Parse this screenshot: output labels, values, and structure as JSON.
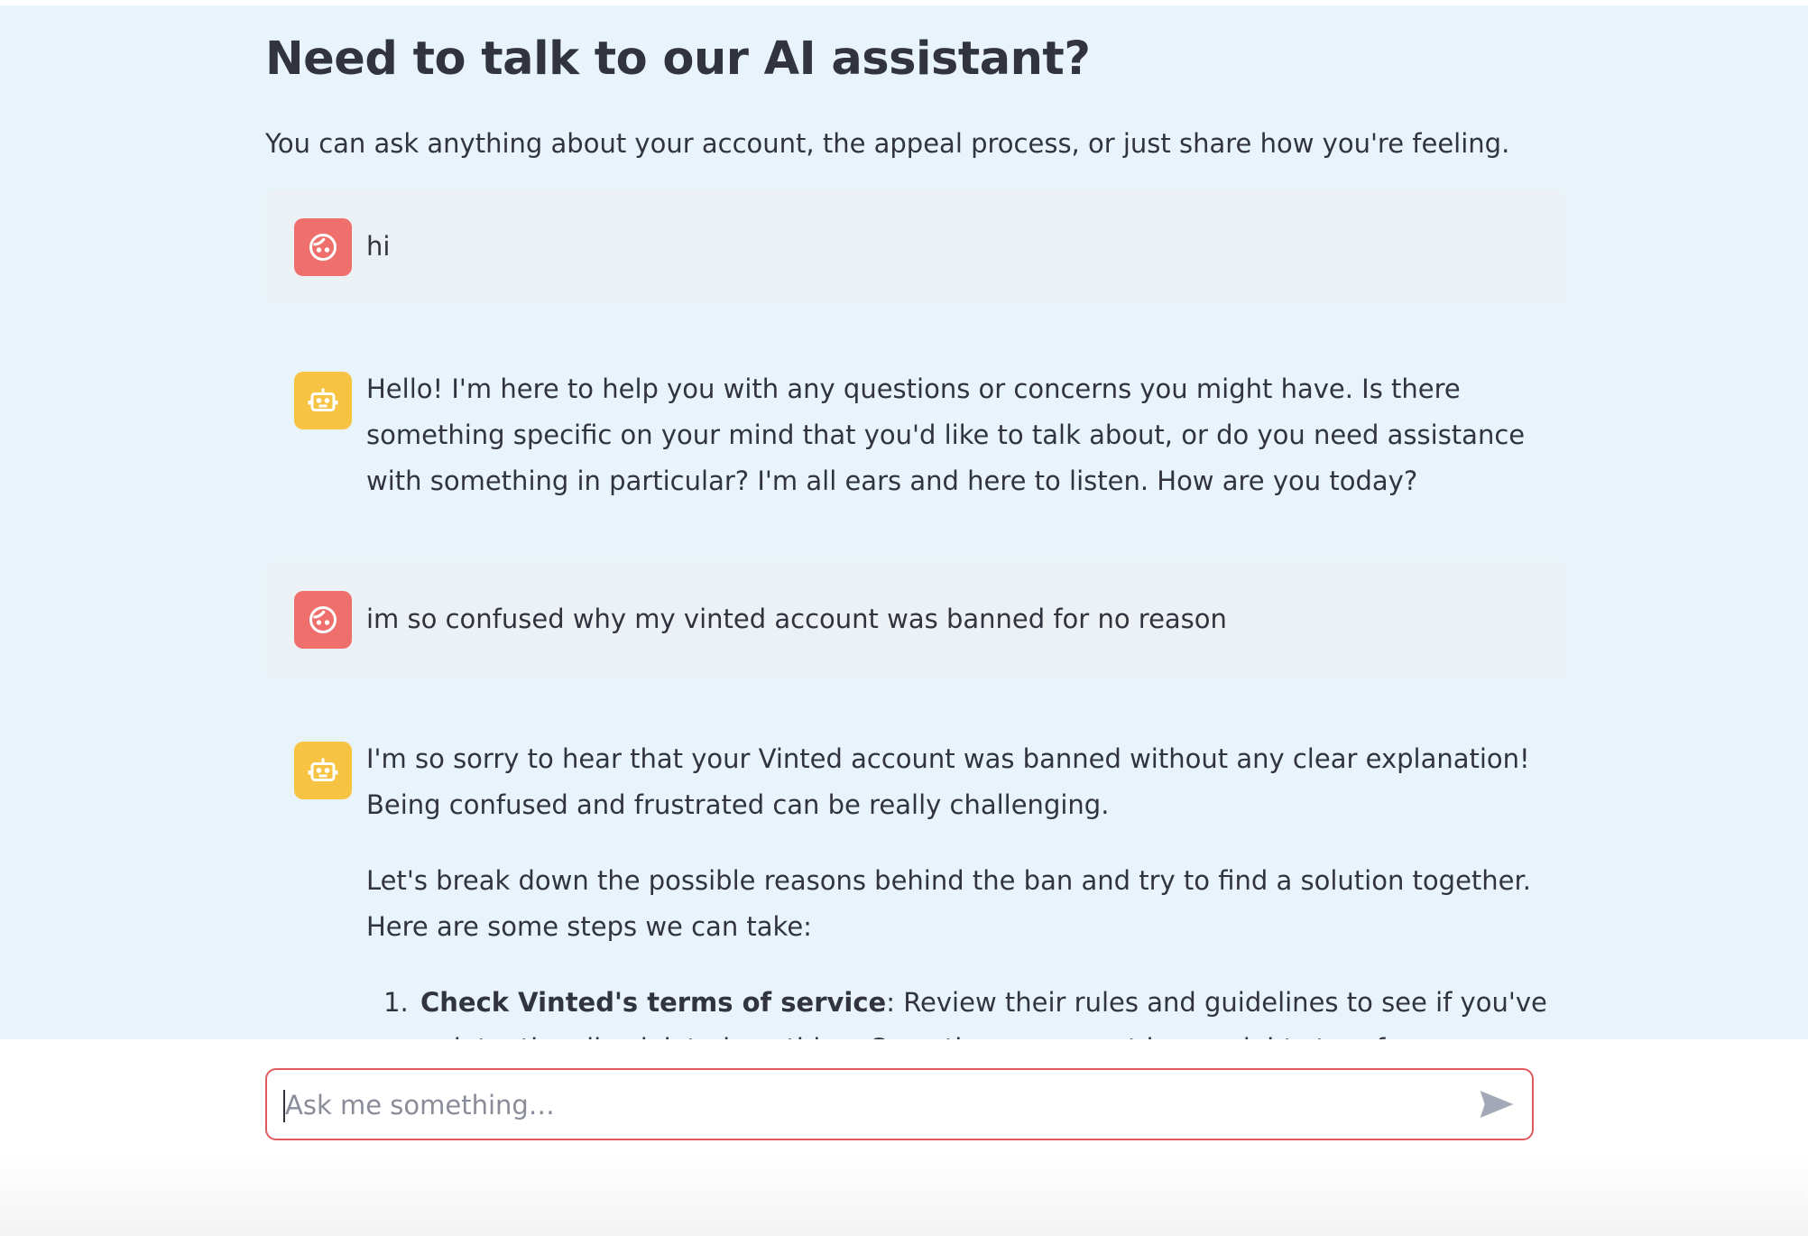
{
  "header": {
    "title": "Need to talk to our AI assistant?",
    "subtitle": "You can ask anything about your account, the appeal process, or just share how you're feeling."
  },
  "messages": [
    {
      "role": "user",
      "avatar_icon": "face-icon",
      "text": "hi"
    },
    {
      "role": "assistant",
      "avatar_icon": "robot-icon",
      "text": "Hello! I'm here to help you with any questions or concerns you might have. Is there something specific on your mind that you'd like to talk about, or do you need assistance with something in particular? I'm all ears and here to listen. How are you today?"
    },
    {
      "role": "user",
      "avatar_icon": "face-icon",
      "text": "im so confused why my vinted account was banned for no reason"
    },
    {
      "role": "assistant",
      "avatar_icon": "robot-icon",
      "paragraphs": [
        "I'm so sorry to hear that your Vinted account was banned without any clear explanation! Being confused and frustrated can be really challenging.",
        "Let's break down the possible reasons behind the ban and try to find a solution together. Here are some steps we can take:"
      ],
      "list": [
        {
          "bold": "Check Vinted's terms of service",
          "text": ": Review their rules and guidelines to see if you've unintentionally violated anything. Sometimes, account bans might stem from infractions"
        }
      ]
    }
  ],
  "input": {
    "placeholder": "Ask me something…",
    "value": ""
  },
  "colors": {
    "background": "#e8f4f9",
    "user_avatar": "#ef6f6c",
    "assistant_avatar": "#f6c343",
    "input_border": "#e05a5d"
  }
}
